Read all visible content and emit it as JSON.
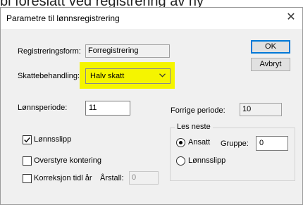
{
  "background_text": "bl foreslått ved registrering av ny",
  "dialog": {
    "title": "Parametre til lønnsregistrering",
    "close_glyph": "✕"
  },
  "fields": {
    "registreringsform": {
      "label": "Registreringsform:",
      "value": "Forregistrering"
    },
    "skattebehandling": {
      "label": "Skattebehandling:",
      "value": "Halv skatt"
    },
    "lonnsperiode": {
      "label": "Lønnsperiode:",
      "value": "11"
    },
    "forrige_periode": {
      "label": "Forrige periode:",
      "value": "10"
    },
    "arstall": {
      "label": "Årstall:",
      "value": "0"
    }
  },
  "buttons": {
    "ok": "OK",
    "avbryt": "Avbryt"
  },
  "checkboxes": {
    "lonnsslipp": {
      "label": "Lønnsslipp",
      "checked": true
    },
    "overstyre_kontering": {
      "label": "Overstyre kontering",
      "checked": false
    },
    "korreksjon": {
      "label": "Korreksjon tidl år",
      "checked": false
    }
  },
  "les_neste": {
    "legend": "Les neste",
    "ansatt_label": "Ansatt",
    "gruppe_label": "Gruppe:",
    "gruppe_value": "0",
    "lonnsslipp_label": "Lønnsslipp",
    "selected": "Ansatt"
  },
  "colors": {
    "highlight": "#f5f500",
    "dialog_bg": "#f0f0f0",
    "default_button_border": "#0078d7"
  }
}
